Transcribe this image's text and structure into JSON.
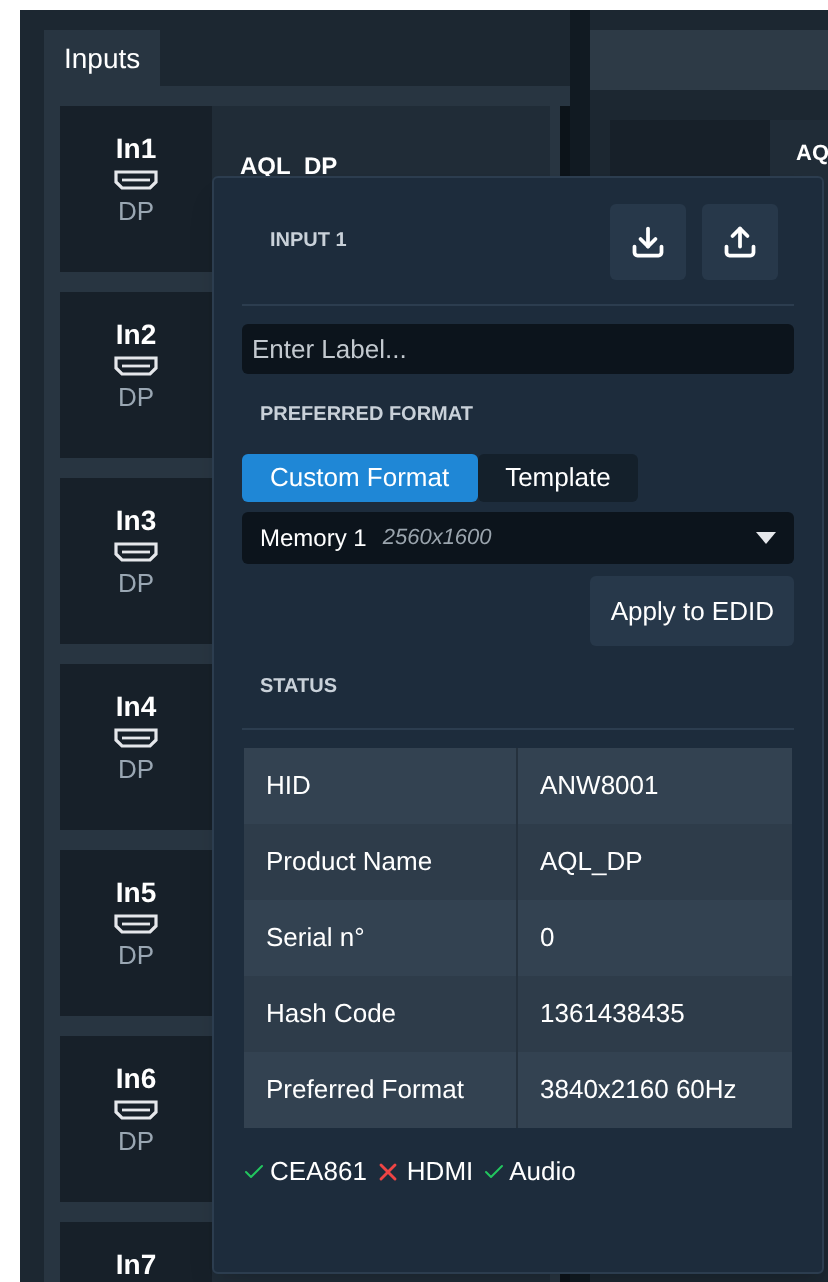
{
  "tab": {
    "label": "Inputs",
    "selected": true
  },
  "inputs": [
    {
      "label": "In1",
      "type": "DP",
      "name": "AQL_DP"
    },
    {
      "label": "In2",
      "type": "DP"
    },
    {
      "label": "In3",
      "type": "DP"
    },
    {
      "label": "In4",
      "type": "DP"
    },
    {
      "label": "In5",
      "type": "DP"
    },
    {
      "label": "In6",
      "type": "DP"
    },
    {
      "label": "In7"
    }
  ],
  "right_panel": {
    "card_name": "AQ"
  },
  "popup": {
    "title": "INPUT 1",
    "label_field": {
      "placeholder": "Enter Label..."
    },
    "section_format": "PREFERRED FORMAT",
    "format_tabs": [
      {
        "label": "Custom Format",
        "selected": true
      },
      {
        "label": "Template",
        "selected": false
      }
    ],
    "select": {
      "value": "Memory 1",
      "detail": "2560x1600"
    },
    "apply_button": "Apply to EDID",
    "section_status": "STATUS",
    "status_rows": [
      {
        "key": "HID",
        "value": "ANW8001"
      },
      {
        "key": "Product Name",
        "value": "AQL_DP"
      },
      {
        "key": "Serial n°",
        "value": "0"
      },
      {
        "key": "Hash Code",
        "value": "1361438435"
      },
      {
        "key": "Preferred Format",
        "value": "3840x2160 60Hz"
      }
    ],
    "flags": [
      {
        "label": "CEA861",
        "ok": true
      },
      {
        "label": "HDMI",
        "ok": false
      },
      {
        "label": "Audio",
        "ok": true
      }
    ]
  }
}
